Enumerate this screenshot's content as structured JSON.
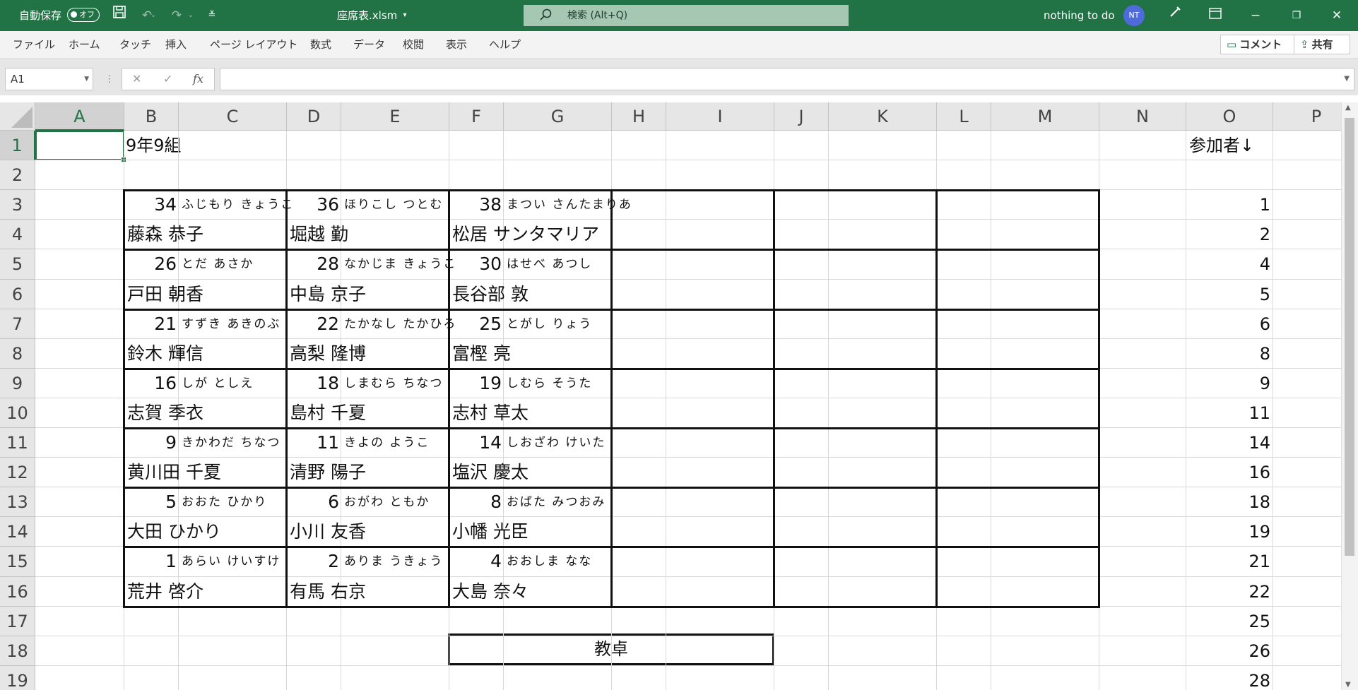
{
  "window": {
    "autosave_label": "自動保存",
    "autosave_state": "オフ",
    "file_name": "座席表.xlsm",
    "search_placeholder": "検索 (Alt+Q)",
    "user_name": "nothing to do",
    "user_initials": "NT"
  },
  "menu": {
    "items": [
      "ファイル",
      "ホーム",
      "タッチ",
      "挿入",
      "ページ レイアウト",
      "数式",
      "データ",
      "校閲",
      "表示",
      "ヘルプ"
    ],
    "comment_label": "コメント",
    "share_label": "共有"
  },
  "formula_bar": {
    "name_box": "A1",
    "fx_label": "fx",
    "formula": ""
  },
  "grid": {
    "columns": [
      "A",
      "B",
      "C",
      "D",
      "E",
      "F",
      "G",
      "H",
      "I",
      "J",
      "K",
      "L",
      "M",
      "N",
      "O",
      "P"
    ],
    "rows": [
      "1",
      "2",
      "3",
      "4",
      "5",
      "6",
      "7",
      "8",
      "9",
      "10",
      "11",
      "12",
      "13",
      "14",
      "15",
      "16",
      "17",
      "18",
      "19"
    ],
    "selected_cell": "A1"
  },
  "sheet": {
    "title": "9年9組",
    "participants_header": "参加者↓",
    "teacher_desk": "教卓",
    "seats": [
      [
        {
          "no": "34",
          "kana": "ふじもり きょうこ",
          "name": "藤森 恭子"
        },
        {
          "no": "36",
          "kana": "ほりこし つとむ",
          "name": "堀越 勤"
        },
        {
          "no": "38",
          "kana": "まつい さんたまりあ",
          "name": "松居 サンタマリア"
        }
      ],
      [
        {
          "no": "26",
          "kana": "とだ あさか",
          "name": "戸田 朝香"
        },
        {
          "no": "28",
          "kana": "なかじま きょうこ",
          "name": "中島 京子"
        },
        {
          "no": "30",
          "kana": "はせべ あつし",
          "name": "長谷部 敦"
        }
      ],
      [
        {
          "no": "21",
          "kana": "すずき あきのぶ",
          "name": "鈴木 輝信"
        },
        {
          "no": "22",
          "kana": "たかなし たかひろ",
          "name": "高梨 隆博"
        },
        {
          "no": "25",
          "kana": "とがし りょう",
          "name": "富樫 亮"
        }
      ],
      [
        {
          "no": "16",
          "kana": "しが としえ",
          "name": "志賀 季衣"
        },
        {
          "no": "18",
          "kana": "しまむら ちなつ",
          "name": "島村 千夏"
        },
        {
          "no": "19",
          "kana": "しむら そうた",
          "name": "志村 草太"
        }
      ],
      [
        {
          "no": "9",
          "kana": "きかわだ ちなつ",
          "name": "黄川田 千夏"
        },
        {
          "no": "11",
          "kana": "きよの ようこ",
          "name": "清野 陽子"
        },
        {
          "no": "14",
          "kana": "しおざわ けいた",
          "name": "塩沢 慶太"
        }
      ],
      [
        {
          "no": "5",
          "kana": "おおた ひかり",
          "name": "大田 ひかり"
        },
        {
          "no": "6",
          "kana": "おがわ ともか",
          "name": "小川 友香"
        },
        {
          "no": "8",
          "kana": "おばた みつおみ",
          "name": "小幡 光臣"
        }
      ],
      [
        {
          "no": "1",
          "kana": "あらい けいすけ",
          "name": "荒井 啓介"
        },
        {
          "no": "2",
          "kana": "ありま うきょう",
          "name": "有馬 右京"
        },
        {
          "no": "4",
          "kana": "おおしま なな",
          "name": "大島 奈々"
        }
      ]
    ],
    "participants": [
      "1",
      "2",
      "4",
      "5",
      "6",
      "8",
      "9",
      "11",
      "14",
      "16",
      "18",
      "19",
      "21",
      "22",
      "25",
      "26",
      "28"
    ]
  }
}
